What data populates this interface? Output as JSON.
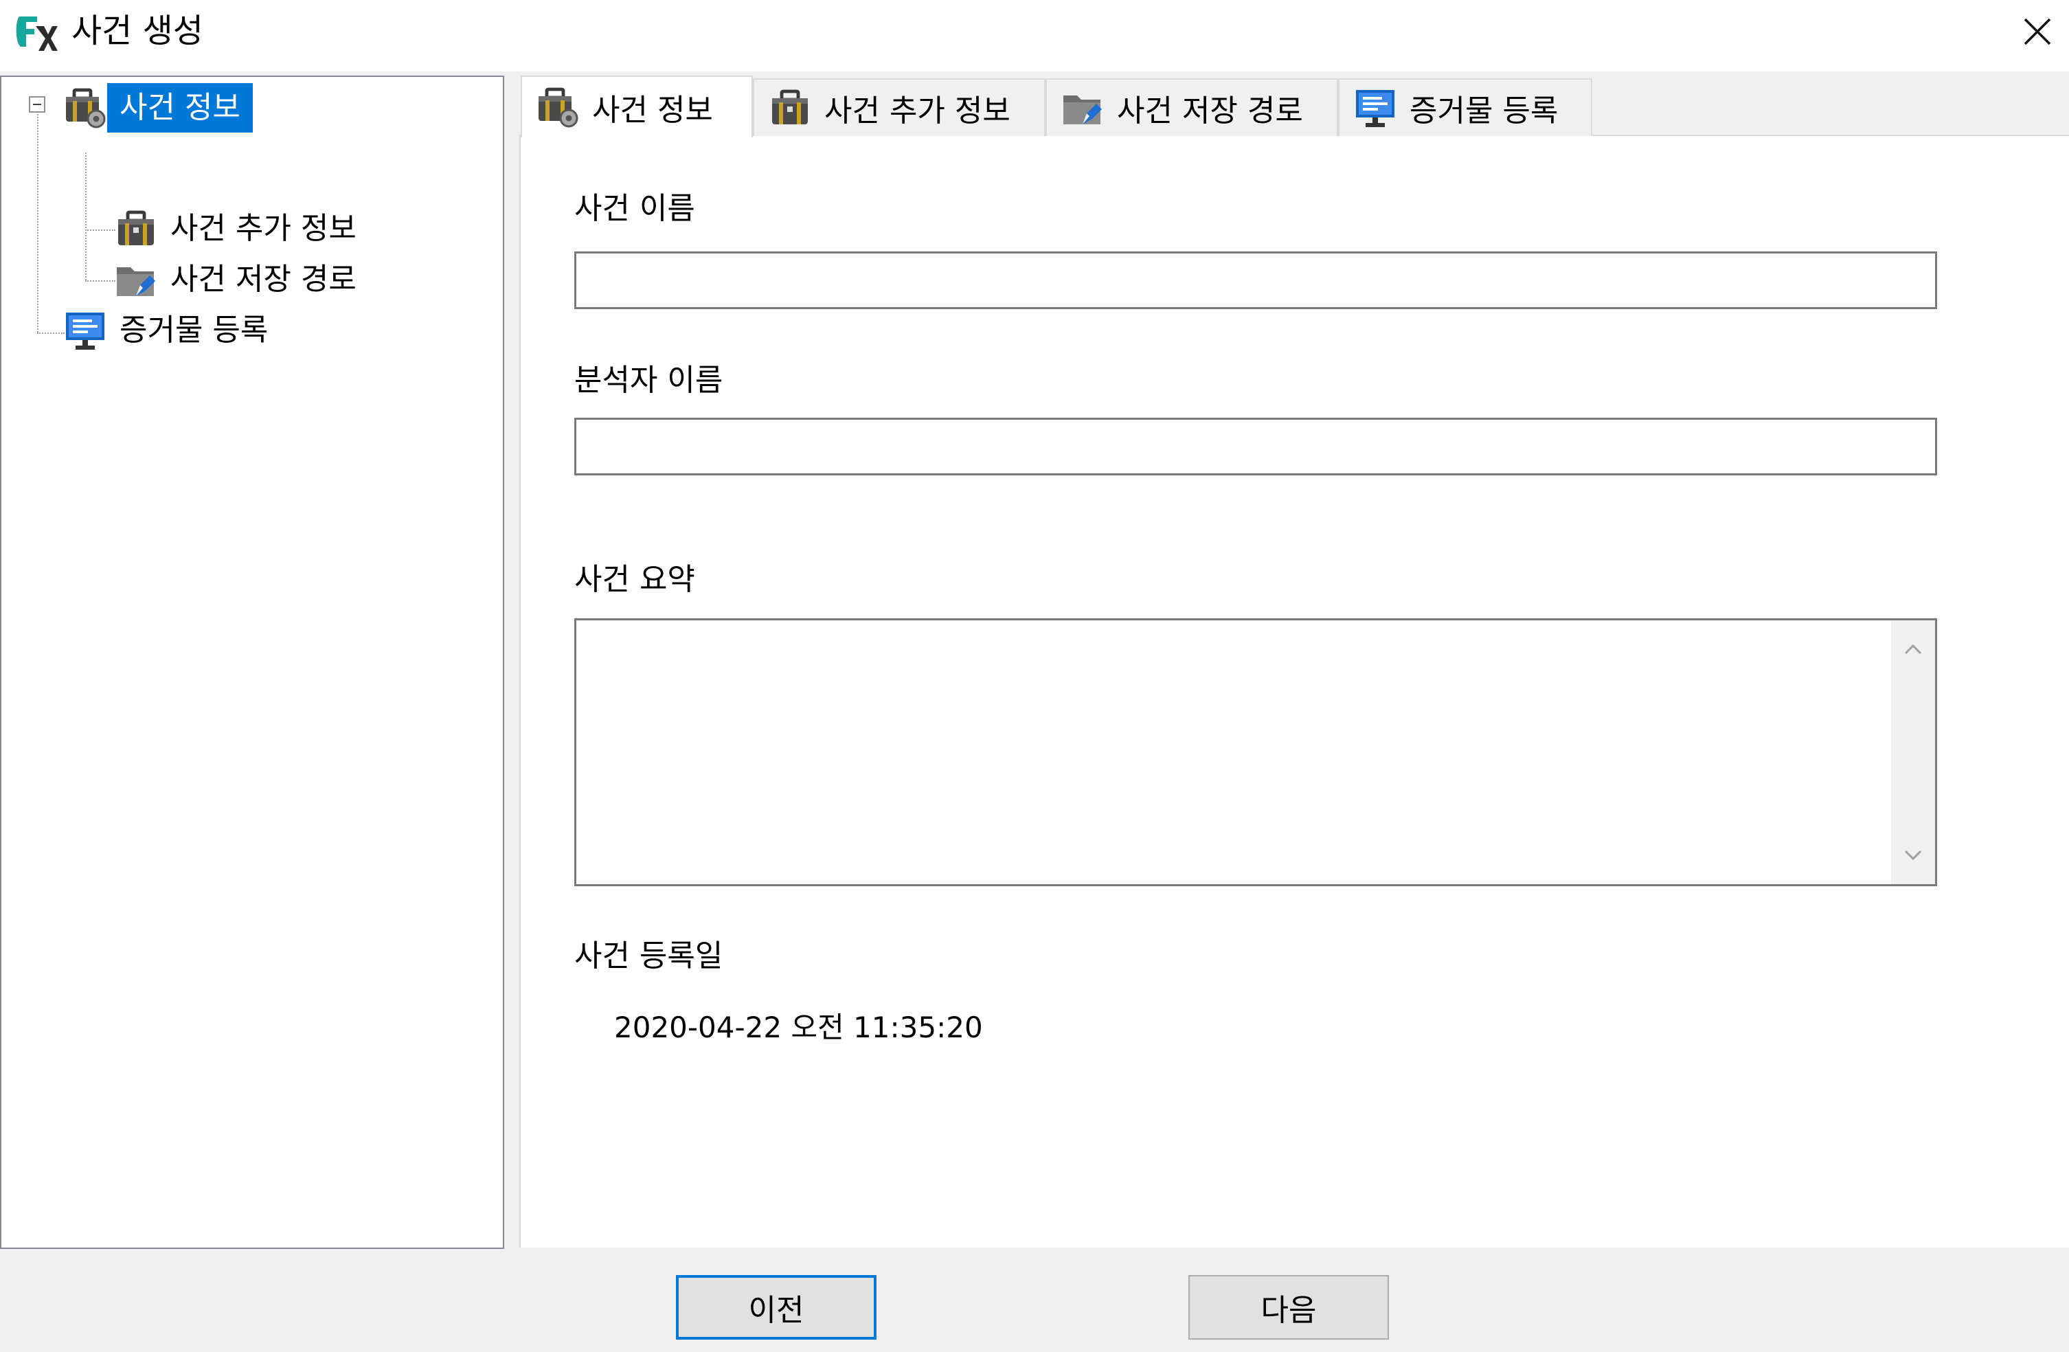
{
  "window": {
    "title": "사건 생성",
    "close_icon": "close-icon"
  },
  "tree": {
    "items": [
      {
        "label": "사건 정보",
        "icon": "briefcase-gear-icon",
        "selected": true,
        "expanded": true
      },
      {
        "label": "사건 추가 정보",
        "icon": "briefcase-icon"
      },
      {
        "label": "사건 저장 경로",
        "icon": "folder-edit-icon"
      },
      {
        "label": "증거물 등록",
        "icon": "monitor-icon"
      }
    ]
  },
  "tabs": [
    {
      "label": "사건 정보",
      "icon": "briefcase-gear-icon",
      "active": true
    },
    {
      "label": "사건 추가 정보",
      "icon": "briefcase-icon"
    },
    {
      "label": "사건 저장 경로",
      "icon": "folder-edit-icon"
    },
    {
      "label": "증거물 등록",
      "icon": "monitor-icon"
    }
  ],
  "form": {
    "case_name_label": "사건 이름",
    "case_name_value": "",
    "analyst_name_label": "분석자 이름",
    "analyst_name_value": "",
    "summary_label": "사건 요약",
    "summary_value": "",
    "registered_label": "사건 등록일",
    "registered_value": "2020-04-22 오전 11:35:20"
  },
  "buttons": {
    "prev": "이전",
    "next": "다음"
  },
  "colors": {
    "selection": "#0078d7",
    "default_button_border": "#0078d7",
    "window_bg": "#f0f0f0"
  }
}
